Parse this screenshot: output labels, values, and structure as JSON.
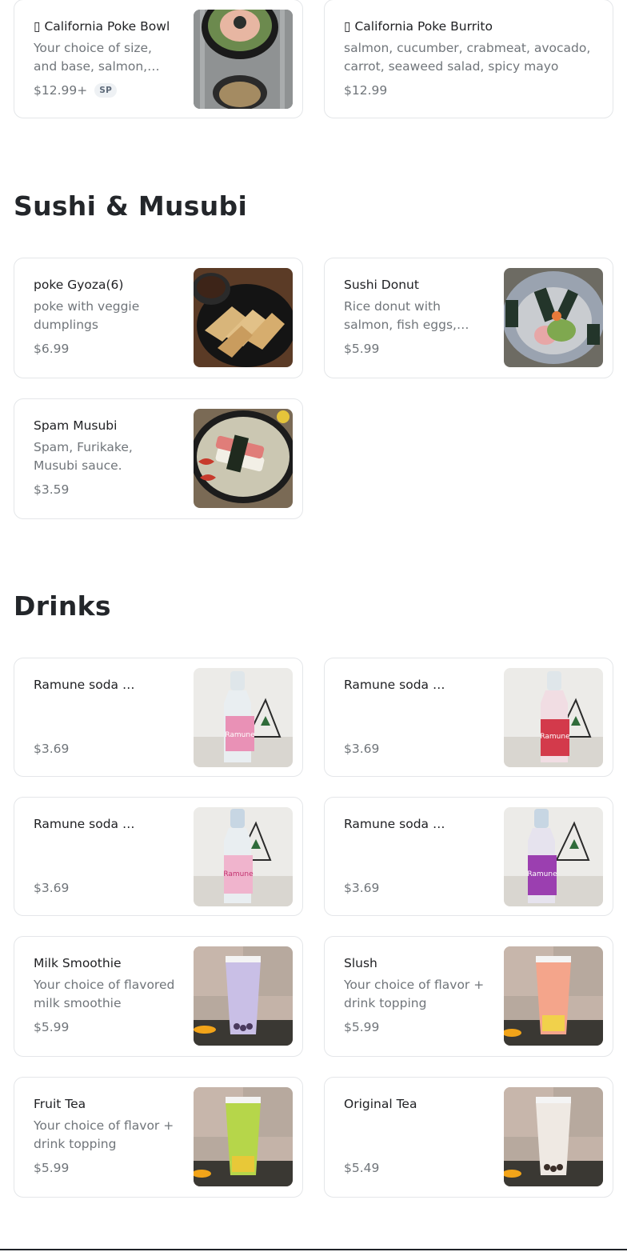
{
  "top_items": [
    {
      "name": "▯ California Poke Bowl",
      "description": "Your choice of size, and base, salmon, tuna, crabmeat",
      "price": "$12.99+",
      "badge": "SP"
    },
    {
      "name": "▯ California Poke Burrito",
      "description": "salmon, cucumber, crabmeat, avocado, carrot, seaweed salad, spicy mayo",
      "price": "$12.99"
    }
  ],
  "sections": [
    {
      "title": "Sushi & Musubi",
      "items": [
        {
          "name": "poke Gyoza(6)",
          "description": "poke with veggie dumplings",
          "price": "$6.99"
        },
        {
          "name": "Sushi Donut",
          "description": "Rice donut with salmon, fish eggs, avocado",
          "price": "$5.99"
        },
        {
          "name": "Spam Musubi",
          "description": "Spam, Furikake, Musubi sauce.",
          "price": "$3.59"
        }
      ]
    },
    {
      "title": "Drinks",
      "items": [
        {
          "name": "Ramune soda Peach",
          "description": "",
          "price": "$3.69"
        },
        {
          "name": "Ramune soda Strawberry",
          "description": "",
          "price": "$3.69"
        },
        {
          "name": "Ramune soda Lychee",
          "description": "",
          "price": "$3.69"
        },
        {
          "name": "Ramune soda Grape",
          "description": "",
          "price": "$3.69"
        },
        {
          "name": "Milk Smoothie",
          "description": "Your choice of flavored milk smoothie",
          "price": "$5.99"
        },
        {
          "name": "Slush",
          "description": "Your choice of flavor + drink topping",
          "price": "$5.99"
        },
        {
          "name": "Fruit Tea",
          "description": "Your choice of flavor + drink topping",
          "price": "$5.99"
        },
        {
          "name": "Original Tea",
          "description": "",
          "price": "$5.49"
        }
      ]
    }
  ],
  "icons": {
    "badge_icon": "sp-badge",
    "item_image": "food-photo"
  },
  "colors": {
    "text": "#202124",
    "muted": "#70757a",
    "border": "#e4e6e9",
    "heading": "#23262a"
  }
}
